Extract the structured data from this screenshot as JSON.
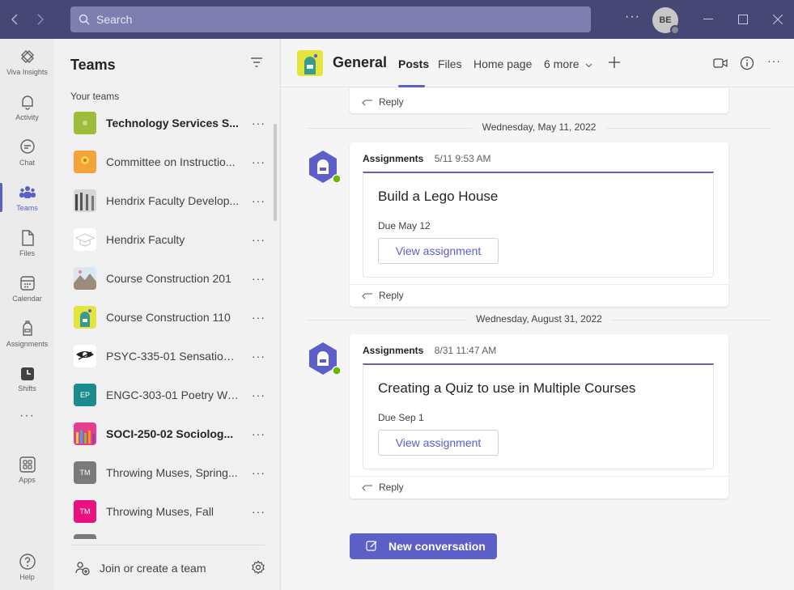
{
  "search": {
    "placeholder": "Search"
  },
  "user": {
    "initials": "BE"
  },
  "rail": {
    "items": [
      {
        "label": "Viva Insights",
        "icon": "viva-insights-icon"
      },
      {
        "label": "Activity",
        "icon": "bell-icon"
      },
      {
        "label": "Chat",
        "icon": "chat-icon"
      },
      {
        "label": "Teams",
        "icon": "teams-icon"
      },
      {
        "label": "Files",
        "icon": "file-icon"
      },
      {
        "label": "Calendar",
        "icon": "calendar-icon"
      },
      {
        "label": "Assignments",
        "icon": "assignments-icon"
      },
      {
        "label": "Shifts",
        "icon": "shifts-icon"
      },
      {
        "label": "Apps",
        "icon": "apps-icon"
      },
      {
        "label": "Help",
        "icon": "help-icon"
      }
    ]
  },
  "teams_panel": {
    "title": "Teams",
    "section_label": "Your teams",
    "teams": [
      {
        "name": "Technology Services S...",
        "initials": "",
        "bold": true
      },
      {
        "name": "Committee on Instructio...",
        "initials": "",
        "bold": false
      },
      {
        "name": "Hendrix Faculty Develop...",
        "initials": "",
        "bold": false
      },
      {
        "name": "Hendrix Faculty",
        "initials": "",
        "bold": false
      },
      {
        "name": "Course Construction 201",
        "initials": "",
        "bold": false
      },
      {
        "name": "Course Construction 110",
        "initials": "",
        "bold": false
      },
      {
        "name": "PSYC-335-01 Sensation ...",
        "initials": "",
        "bold": false
      },
      {
        "name": "ENGC-303-01 Poetry Wr...",
        "initials": "EP",
        "bold": false
      },
      {
        "name": "SOCI-250-02 Sociolog...",
        "initials": "",
        "bold": true
      },
      {
        "name": "Throwing Muses, Spring...",
        "initials": "TM",
        "bold": false
      },
      {
        "name": "Throwing Muses, Fall",
        "initials": "TM",
        "bold": false
      }
    ],
    "join_label": "Join or create a team"
  },
  "channel": {
    "title": "General",
    "tabs": [
      "Posts",
      "Files",
      "Home page",
      "6 more"
    ]
  },
  "feed": {
    "reply_label": "Reply",
    "date_1": "Wednesday, May 11, 2022",
    "date_2": "Wednesday, August 31, 2022",
    "posts": [
      {
        "author": "Assignments",
        "time": "5/11 9:53 AM",
        "assignment_title": "Build a Lego House",
        "due": "Due May 12",
        "button": "View assignment"
      },
      {
        "author": "Assignments",
        "time": "8/31 11:47 AM",
        "assignment_title": "Creating a Quiz to use in Multiple Courses",
        "due": "Due Sep 1",
        "button": "View assignment"
      }
    ],
    "new_conversation": "New conversation"
  },
  "colors": {
    "brand": "#5b5fc7",
    "titlebar": "#464775",
    "accent_line": "#6264a7"
  }
}
